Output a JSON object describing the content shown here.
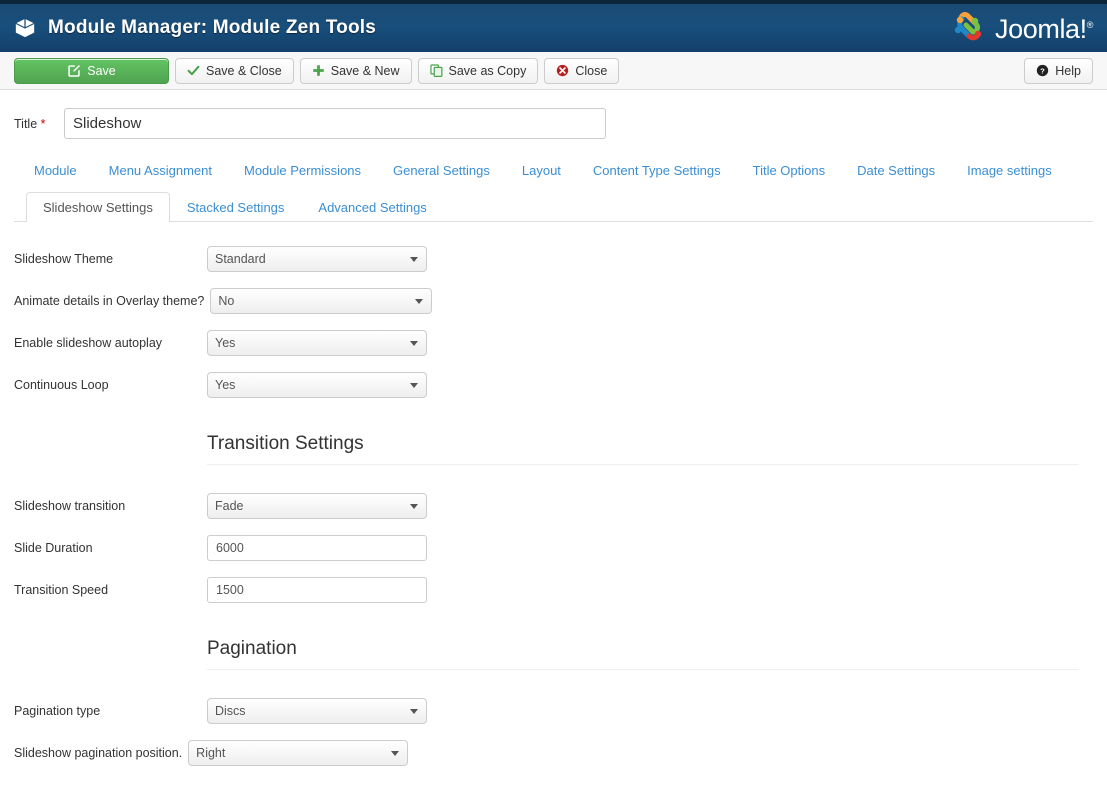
{
  "header": {
    "title": "Module Manager: Module Zen Tools",
    "icon": "cube-icon",
    "brand": "Joomla!",
    "brand_mark": "®",
    "bg_color": "#194f7c"
  },
  "toolbar": {
    "save_label": "Save",
    "save_close_label": "Save & Close",
    "save_new_label": "Save & New",
    "save_copy_label": "Save as Copy",
    "close_label": "Close",
    "help_label": "Help",
    "save_color": "#5bb75b"
  },
  "title_field": {
    "label": "Title",
    "required_mark": "*",
    "value": "Slideshow"
  },
  "tabs_primary": [
    {
      "label": "Module"
    },
    {
      "label": "Menu Assignment"
    },
    {
      "label": "Module Permissions"
    },
    {
      "label": "General Settings"
    },
    {
      "label": "Layout"
    },
    {
      "label": "Content Type Settings"
    },
    {
      "label": "Title Options"
    },
    {
      "label": "Date Settings"
    },
    {
      "label": "Image settings"
    }
  ],
  "tabs_secondary": [
    {
      "label": "Slideshow Settings",
      "active": true
    },
    {
      "label": "Stacked Settings",
      "active": false
    },
    {
      "label": "Advanced Settings",
      "active": false
    }
  ],
  "form": {
    "slideshow_theme": {
      "label": "Slideshow Theme",
      "value": "Standard"
    },
    "animate_details": {
      "label": "Animate details in Overlay theme?",
      "value": "No"
    },
    "autoplay": {
      "label": "Enable slideshow autoplay",
      "value": "Yes"
    },
    "continuous_loop": {
      "label": "Continuous Loop",
      "value": "Yes"
    },
    "transition_heading": "Transition Settings",
    "slideshow_transition": {
      "label": "Slideshow transition",
      "value": "Fade"
    },
    "slide_duration": {
      "label": "Slide Duration",
      "value": "6000"
    },
    "transition_speed": {
      "label": "Transition Speed",
      "value": "1500"
    },
    "pagination_heading": "Pagination",
    "pagination_type": {
      "label": "Pagination type",
      "value": "Discs"
    },
    "pagination_position": {
      "label": "Slideshow pagination position.",
      "value": "Right"
    }
  }
}
